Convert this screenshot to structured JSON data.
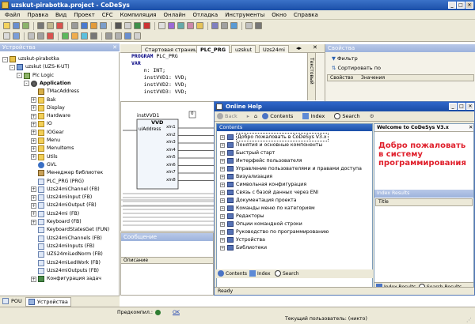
{
  "window": {
    "title": "uzskut-pirabotka.project - CoDeSys",
    "controls": [
      "_",
      "□",
      "✕"
    ]
  },
  "menu": [
    "Файл",
    "Правка",
    "Вид",
    "Проект",
    "CFC",
    "Компиляция",
    "Онлайн",
    "Отладка",
    "Инструменты",
    "Окно",
    "Справка"
  ],
  "devices_panel": {
    "title": "Устройства",
    "items": [
      {
        "label": "uzskut-pirabotka",
        "depth": 0,
        "icon": "project-icon",
        "exp": "-"
      },
      {
        "label": "uzskut (UZS-K-UT)",
        "depth": 1,
        "icon": "device-icon",
        "exp": "-"
      },
      {
        "label": "Plc Logic",
        "depth": 2,
        "icon": "plc-icon",
        "exp": "-"
      },
      {
        "label": "Application",
        "depth": 3,
        "icon": "app-icon",
        "exp": "-"
      },
      {
        "label": "TMacAddress",
        "depth": 4,
        "icon": "struct-icon",
        "exp": ""
      },
      {
        "label": "Bak",
        "depth": 4,
        "icon": "folder-icon",
        "exp": "+"
      },
      {
        "label": "Display",
        "depth": 4,
        "icon": "folder-icon",
        "exp": "+"
      },
      {
        "label": "Hardware",
        "depth": 4,
        "icon": "folder-icon",
        "exp": "+"
      },
      {
        "label": "IO",
        "depth": 4,
        "icon": "folder-icon",
        "exp": "+"
      },
      {
        "label": "IOGear",
        "depth": 4,
        "icon": "folder-icon",
        "exp": "+"
      },
      {
        "label": "Menu",
        "depth": 4,
        "icon": "folder-icon",
        "exp": "+"
      },
      {
        "label": "MenuItems",
        "depth": 4,
        "icon": "folder-icon",
        "exp": "+"
      },
      {
        "label": "Utils",
        "depth": 4,
        "icon": "folder-icon",
        "exp": "+"
      },
      {
        "label": "GVL",
        "depth": 4,
        "icon": "gvl-icon",
        "exp": ""
      },
      {
        "label": "Менеджер библиотек",
        "depth": 4,
        "icon": "library-icon",
        "exp": ""
      },
      {
        "label": "PLC_PRG (PRG)",
        "depth": 4,
        "icon": "pou-icon",
        "exp": ""
      },
      {
        "label": "Uzs24miChannel (FB)",
        "depth": 4,
        "icon": "pou-icon",
        "exp": "+"
      },
      {
        "label": "Uzs24miInput (FB)",
        "depth": 4,
        "icon": "pou-icon",
        "exp": "+"
      },
      {
        "label": "Uzs24miOutput (FB)",
        "depth": 4,
        "icon": "pou-icon",
        "exp": "+"
      },
      {
        "label": "Uzs24mi (FB)",
        "depth": 4,
        "icon": "pou-icon",
        "exp": "+"
      },
      {
        "label": "Keyboard (FB)",
        "depth": 4,
        "icon": "pou-icon",
        "exp": "+"
      },
      {
        "label": "KeyboardStatesGet (FUN)",
        "depth": 4,
        "icon": "pou-icon",
        "exp": ""
      },
      {
        "label": "Uzs24miChannels (FB)",
        "depth": 4,
        "icon": "pou-icon",
        "exp": ""
      },
      {
        "label": "Uzs24miInputs (FB)",
        "depth": 4,
        "icon": "pou-icon",
        "exp": ""
      },
      {
        "label": "UZS24miLedNorm (FB)",
        "depth": 4,
        "icon": "pou-icon",
        "exp": ""
      },
      {
        "label": "Uzs24miLedWork (FB)",
        "depth": 4,
        "icon": "pou-icon",
        "exp": ""
      },
      {
        "label": "Uzs24miOutputs (FB)",
        "depth": 4,
        "icon": "pou-icon",
        "exp": ""
      },
      {
        "label": "Конфигурация задач",
        "depth": 4,
        "icon": "task-config-icon",
        "exp": "+"
      }
    ],
    "bottom_tabs": [
      "POU",
      "Устройства"
    ]
  },
  "editor": {
    "tabs": [
      "Стартовая страница",
      "PLC_PRG",
      "uzskut",
      "Uzs24mi"
    ],
    "side_tab": "Текстовый",
    "code_lines": [
      {
        "kw": "PROGRAM",
        "rest": " PLC_PRG"
      },
      {
        "kw": "VAR",
        "rest": ""
      },
      {
        "kw": "",
        "rest": "    n: INT;"
      },
      {
        "kw": "",
        "rest": "    instVVD1: VVD;"
      },
      {
        "kw": "",
        "rest": "    instVVD2: VVD;"
      },
      {
        "kw": "",
        "rest": "    instVVD3: VVD;"
      }
    ]
  },
  "fbd": {
    "instance": "instVVD1",
    "type": "VVD",
    "number": "0",
    "input": "uiAddress",
    "outputs": [
      "xln1",
      "xln2",
      "xln3",
      "xln4",
      "xln5",
      "xln6",
      "xln7",
      "xln8"
    ]
  },
  "messages_panel": {
    "title": "Сообщение",
    "column": "Описание"
  },
  "properties_panel": {
    "title": "Свойства",
    "filter_label": "Фильтр",
    "sort_label": "Сортировать по",
    "columns": [
      "Свойство",
      "Значения"
    ]
  },
  "help": {
    "title": "Online Help",
    "toolbar": [
      "Back",
      "Contents",
      "Index",
      "Search"
    ],
    "contents_header": "Contents",
    "contents_items": [
      "Добро пожаловать в CoDeSys V3.x",
      "Понятия и основные компоненты",
      "Быстрый старт",
      "Интерфейс пользователя",
      "Управление пользователями и правами доступа",
      "Визуализация",
      "Символьная конфигурация",
      "Связь с базой данных через ENI",
      "Документация проекта",
      "Команды меню по категориям",
      "Редакторы",
      "Опции командной строки",
      "Руководство по программированию",
      "Устройства",
      "Библиотеки"
    ],
    "welcome_tab": "Welcome to CoDeSys V3.x",
    "welcome_text": "Добро пожаловать в систему программирования",
    "index_results_header": "Index Results",
    "index_results_column": "Title",
    "bottom_left_tabs": [
      "Contents",
      "Index",
      "Search"
    ],
    "bottom_right_tabs": [
      "Index Results",
      "Search Results"
    ],
    "status": "Ready"
  },
  "status_bar": {
    "precompile_label": "Предкомпил.:",
    "precompile_value": "OK",
    "user_text": "Текущий пользователь: (никто)"
  },
  "colors": {
    "title_blue": "#1b4fa8",
    "welcome_red": "#e0202c",
    "chrome": "#ece9d8"
  }
}
